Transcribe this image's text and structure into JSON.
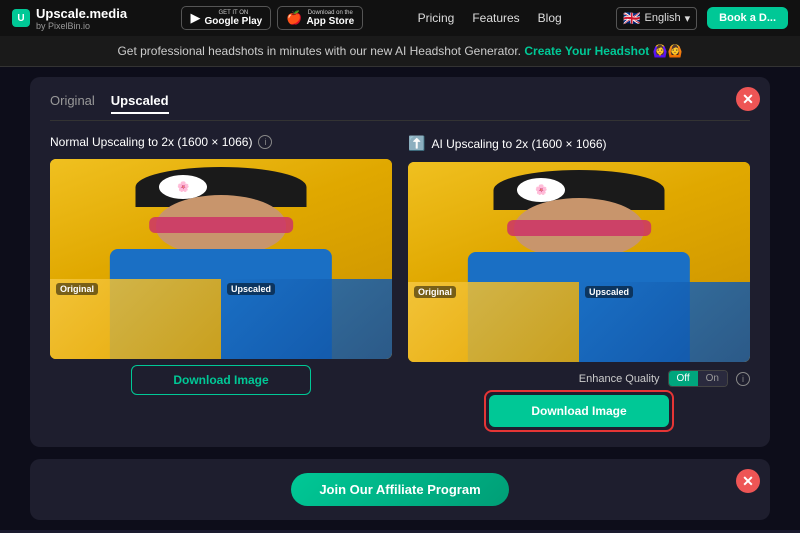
{
  "navbar": {
    "logo_text": "Upscale.media",
    "logo_sub": "by PixelBin.io",
    "logo_icon": "U",
    "google_play_label_top": "GET IT ON",
    "google_play_label_main": "Google Play",
    "app_store_label_top": "Download on the",
    "app_store_label_main": "App Store",
    "links": [
      "Pricing",
      "Features",
      "Blog"
    ],
    "language": "English",
    "book_btn": "Book a D..."
  },
  "banner": {
    "text": "Get professional headshots in minutes with our new AI Headshot Generator.",
    "link_text": "Create Your Headshot",
    "emoji": "🙆‍♀️🙆"
  },
  "modal": {
    "tabs": [
      "Original",
      "Upscaled"
    ],
    "active_tab": "Upscaled",
    "left_column": {
      "title": "Normal Upscaling to 2x (1600 × 1066)",
      "info": "i",
      "download_btn": "Download Image"
    },
    "right_column": {
      "title": "AI Upscaling to 2x (1600 × 1066)",
      "upscale_icon": "⬆",
      "enhance_label": "Enhance Quality",
      "toggle_off": "Off",
      "toggle_on": "On",
      "download_btn": "Download Image"
    },
    "close_icon": "✕"
  },
  "bottom_card": {
    "affiliate_btn": "Join Our Affiliate Program",
    "close_icon": "✕"
  },
  "comparison": {
    "labels": [
      "Original",
      "Upscaled",
      "Original",
      "Upscaled"
    ]
  }
}
